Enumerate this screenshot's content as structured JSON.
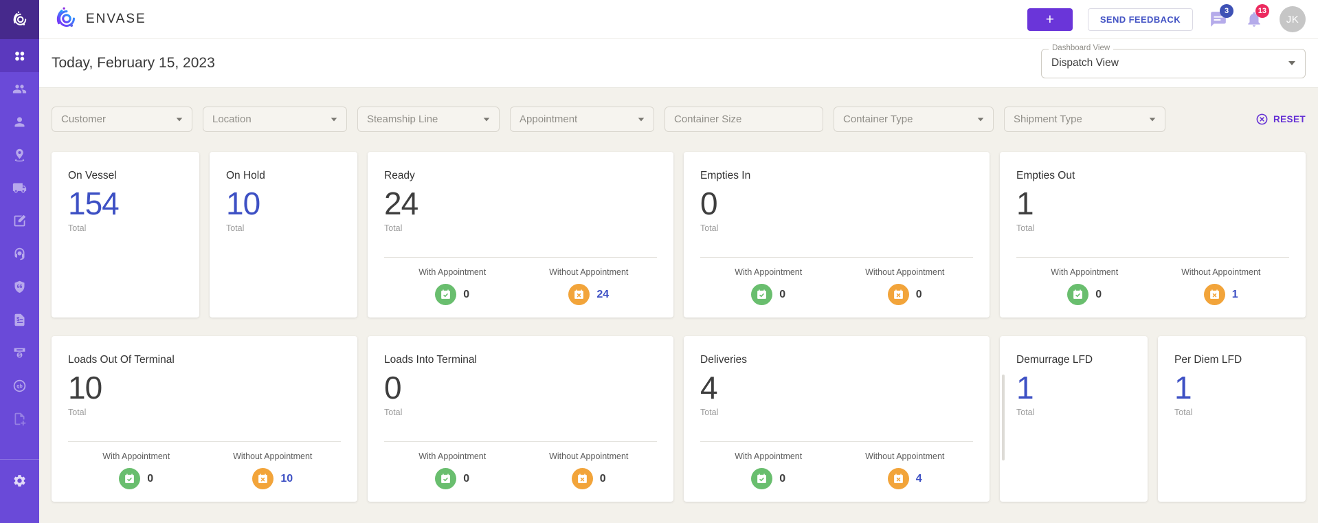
{
  "brand": {
    "name": "ENVASE"
  },
  "header": {
    "add_label": "+",
    "send_feedback_label": "SEND FEEDBACK",
    "chat_badge": "3",
    "notifications_badge": "13",
    "avatar_initials": "JK"
  },
  "toolbar": {
    "date_title": "Today, February 15, 2023",
    "dashboard_view_label": "Dashboard View",
    "dashboard_view_value": "Dispatch View"
  },
  "filters": {
    "customer": "Customer",
    "location": "Location",
    "steamship_line": "Steamship Line",
    "appointment": "Appointment",
    "container_size": "Container Size",
    "container_type": "Container Type",
    "shipment_type": "Shipment Type",
    "reset_label": "RESET"
  },
  "labels": {
    "total": "Total",
    "with_appointment": "With Appointment",
    "without_appointment": "Without Appointment"
  },
  "sidebar": {
    "icon_names": [
      "envase-logo",
      "dashboard-grid",
      "customers",
      "drivers",
      "locations",
      "trucks",
      "orders-edit",
      "dispatch-support",
      "quotes",
      "invoices",
      "payments",
      "quickbooks",
      "new-document",
      "settings"
    ],
    "quote_icon_glyph": "66",
    "quickbooks_icon_glyph": "qb"
  },
  "icon_colors": {
    "with_appointment_green": "#69BE6E",
    "without_appointment_orange": "#F2A43A",
    "accent_blue": "#3D50C4",
    "sidebar_purple": "#6A4AD8",
    "primary_purple": "#6A35D9"
  },
  "cards": [
    {
      "title": "On Vessel",
      "total": "154"
    },
    {
      "title": "On Hold",
      "total": "10"
    },
    {
      "title": "Ready",
      "total": "24",
      "with_appointment": "0",
      "without_appointment": "24"
    },
    {
      "title": "Empties In",
      "total": "0",
      "with_appointment": "0",
      "without_appointment": "0"
    },
    {
      "title": "Empties Out",
      "total": "1",
      "with_appointment": "0",
      "without_appointment": "1"
    },
    {
      "title": "Loads Out Of Terminal",
      "total": "10",
      "with_appointment": "0",
      "without_appointment": "10"
    },
    {
      "title": "Loads Into Terminal",
      "total": "0",
      "with_appointment": "0",
      "without_appointment": "0"
    },
    {
      "title": "Deliveries",
      "total": "4",
      "with_appointment": "0",
      "without_appointment": "4"
    },
    {
      "title": "Demurrage LFD",
      "total": "1"
    },
    {
      "title": "Per Diem LFD",
      "total": "1"
    }
  ]
}
